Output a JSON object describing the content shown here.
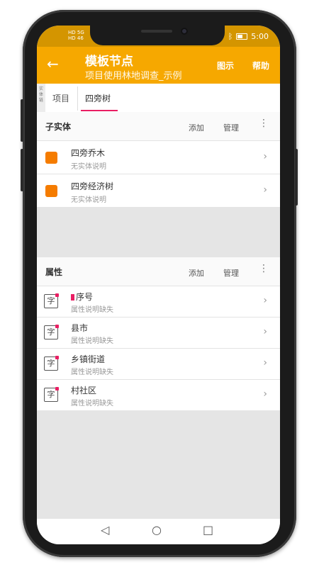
{
  "status": {
    "left_line1": "HD 5G",
    "left_line2": "HD 46",
    "icons": [
      "alarm-icon",
      "bluetooth-icon",
      "battery-icon"
    ],
    "time": "5:00"
  },
  "appbar": {
    "title": "模板节点",
    "subtitle": "项目使用林地调查_示例",
    "actions": {
      "chart": "图示",
      "help": "帮助"
    },
    "color": "#f6a800"
  },
  "breadcrumb": {
    "vertical_label": "实体链",
    "items": [
      "项目",
      "四旁树"
    ],
    "active_index": 1
  },
  "sub_entities": {
    "title": "子实体",
    "add": "添加",
    "manage": "管理",
    "items": [
      {
        "title": "四旁乔木",
        "subtitle": "无实体说明"
      },
      {
        "title": "四旁经济树",
        "subtitle": "无实体说明"
      }
    ]
  },
  "attributes": {
    "title": "属性",
    "add": "添加",
    "manage": "管理",
    "type_icon": "字",
    "items": [
      {
        "title": "序号",
        "subtitle": "属性说明缺失",
        "bookmarked": true
      },
      {
        "title": "县市",
        "subtitle": "属性说明缺失"
      },
      {
        "title": "乡镇街道",
        "subtitle": "属性说明缺失"
      },
      {
        "title": "村社区",
        "subtitle": "属性说明缺失"
      }
    ]
  },
  "colors": {
    "accent": "#e91e63",
    "entity": "#f57c00",
    "statusbar": "#d49500"
  }
}
